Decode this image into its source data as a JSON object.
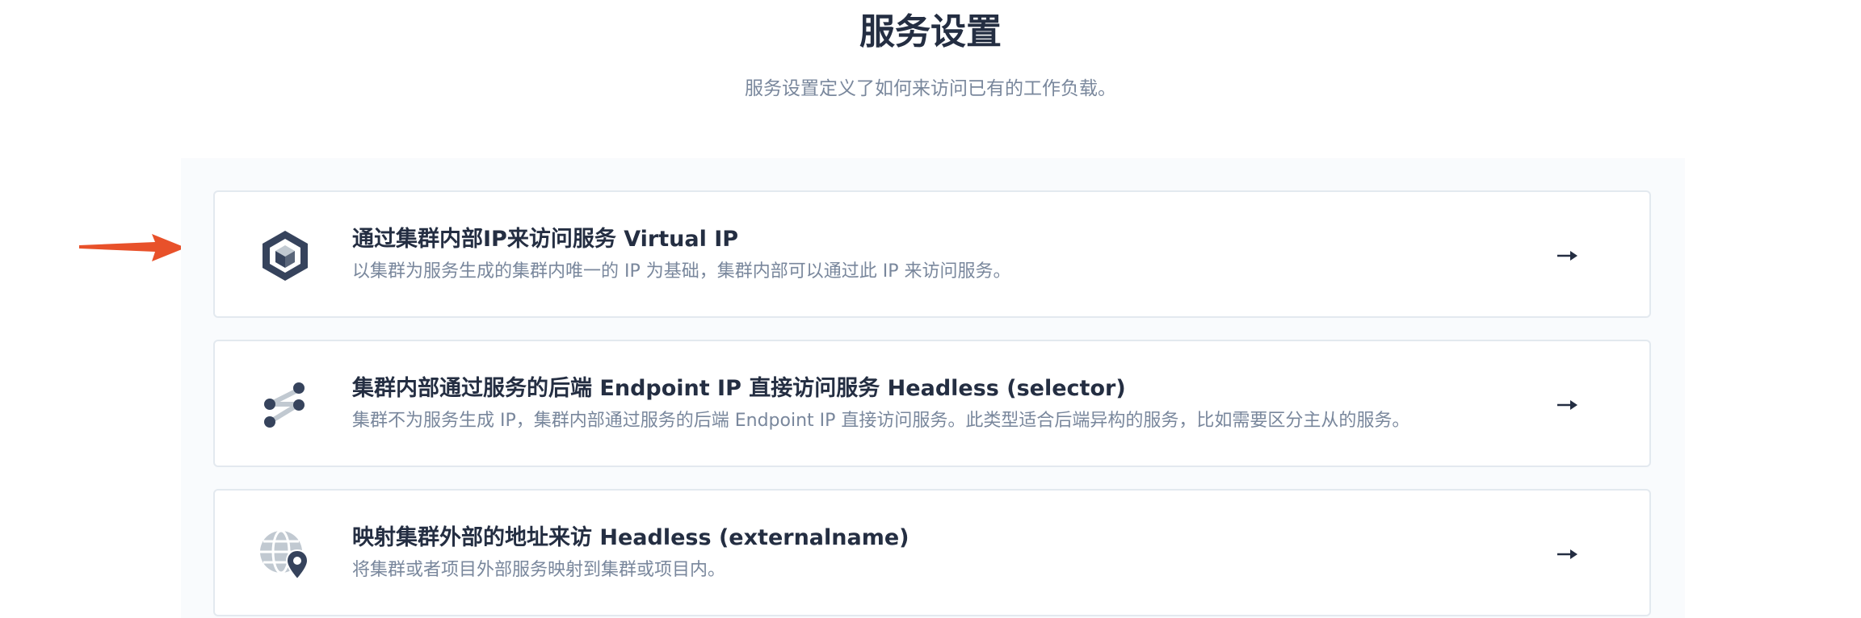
{
  "header": {
    "title": "服务设置",
    "subtitle": "服务设置定义了如何来访问已有的工作负载。"
  },
  "options": [
    {
      "icon": "virtual-ip-cube-icon",
      "title": "通过集群内部IP来访问服务 Virtual IP",
      "description": "以集群为服务生成的集群内唯一的 IP 为基础，集群内部可以通过此 IP 来访问服务。"
    },
    {
      "icon": "share-nodes-icon",
      "title": "集群内部通过服务的后端 Endpoint IP 直接访问服务 Headless (selector)",
      "description": "集群不为服务生成 IP，集群内部通过服务的后端 Endpoint IP 直接访问服务。此类型适合后端异构的服务，比如需要区分主从的服务。"
    },
    {
      "icon": "globe-location-icon",
      "title": "映射集群外部的地址来访 Headless (externalname)",
      "description": "将集群或者项目外部服务映射到集群或项目内。"
    }
  ],
  "colors": {
    "title_text": "#242e42",
    "secondary_text": "#79879c",
    "card_border": "#e3e9ef",
    "panel_bg": "#f9fbfd",
    "annotation_arrow": "#e8512a"
  }
}
